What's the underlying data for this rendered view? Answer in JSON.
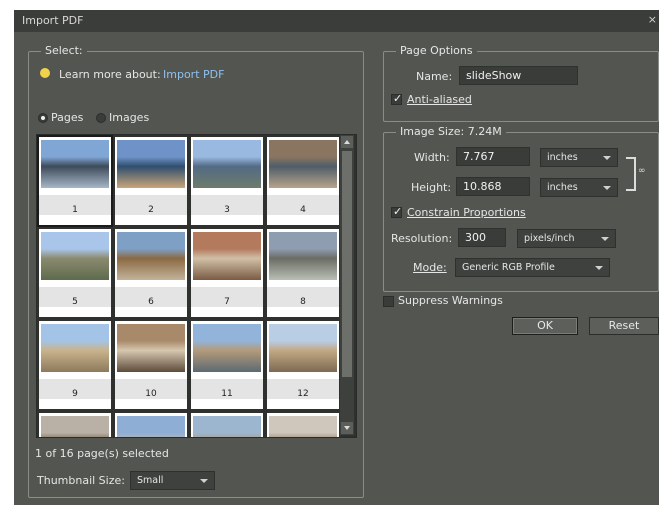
{
  "window": {
    "title": "Import PDF",
    "close_glyph": "×"
  },
  "select_group": {
    "legend": "Select:",
    "learn_more_prefix": "Learn more about:",
    "learn_more_link": "Import PDF",
    "radio_pages": "Pages",
    "radio_images": "Images",
    "thumbnails": [
      {
        "num": "1",
        "selected": true
      },
      {
        "num": "2"
      },
      {
        "num": "3"
      },
      {
        "num": "4"
      },
      {
        "num": "5"
      },
      {
        "num": "6"
      },
      {
        "num": "7"
      },
      {
        "num": "8"
      },
      {
        "num": "9"
      },
      {
        "num": "10"
      },
      {
        "num": "11"
      },
      {
        "num": "12"
      },
      {
        "num": ""
      },
      {
        "num": ""
      },
      {
        "num": ""
      },
      {
        "num": ""
      }
    ],
    "status": "1 of 16 page(s) selected",
    "thumb_size_label": "Thumbnail Size:",
    "thumb_size_value": "Small"
  },
  "page_options": {
    "legend": "Page Options",
    "name_label": "Name:",
    "name_value": "slideShow",
    "anti_aliased_label": "Anti-aliased",
    "anti_aliased_checked": true
  },
  "image_size": {
    "legend": "Image Size: 7.24M",
    "width_label": "Width:",
    "width_value": "7.767",
    "width_unit": "inches",
    "height_label": "Height:",
    "height_value": "10.868",
    "height_unit": "inches",
    "constrain_label": "Constrain Proportions",
    "constrain_checked": true,
    "resolution_label": "Resolution:",
    "resolution_value": "300",
    "resolution_unit": "pixels/inch",
    "mode_label": "Mode:",
    "mode_value": "Generic RGB Profile"
  },
  "suppress_warnings_label": "Suppress Warnings",
  "buttons": {
    "ok": "OK",
    "reset": "Reset"
  }
}
